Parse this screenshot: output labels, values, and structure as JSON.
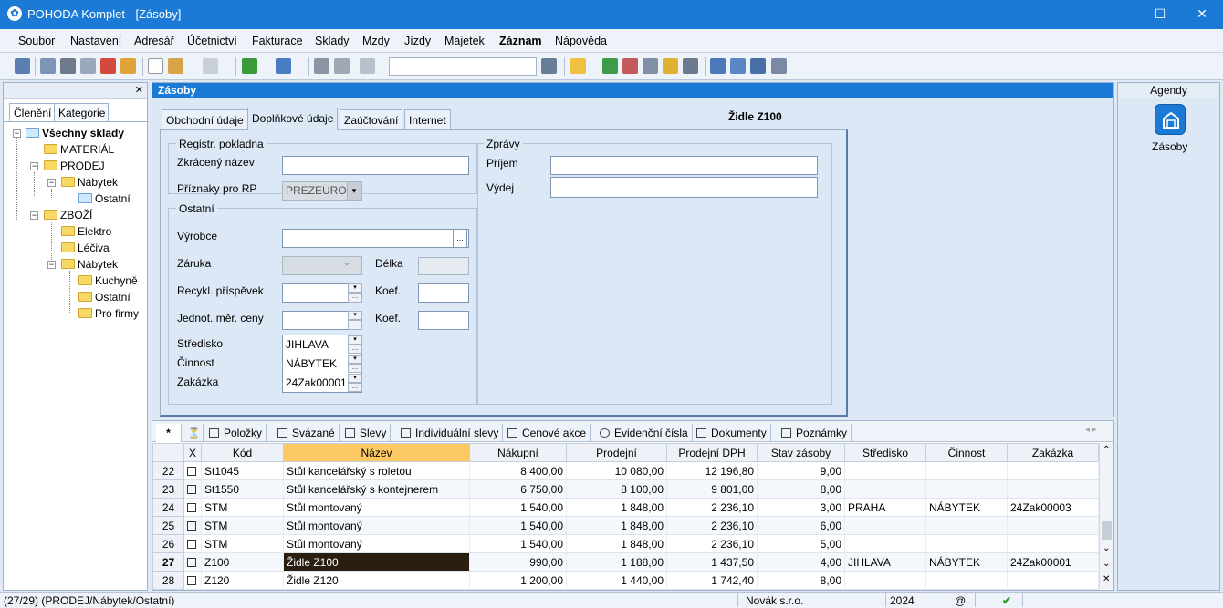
{
  "window": {
    "title": "POHODA Komplet - [Zásoby]",
    "min": "—",
    "max": "☐",
    "close": "✕"
  },
  "menu": [
    "Soubor",
    "Nastavení",
    "Adresář",
    "Účetnictví",
    "Fakturace",
    "Sklady",
    "Mzdy",
    "Jízdy",
    "Majetek",
    "Záznam",
    "Nápověda"
  ],
  "left": {
    "close": "✕",
    "tabs": [
      "Členění",
      "Kategorie"
    ],
    "tree": [
      "Všechny sklady",
      "MATERIÁL",
      "PRODEJ",
      "Nábytek",
      "Ostatní",
      "ZBOŽÍ",
      "Elektro",
      "Léčiva",
      "Nábytek",
      "Kuchyně",
      "Ostatní",
      "Pro firmy"
    ]
  },
  "main": {
    "title": "Zásoby",
    "tabs": [
      "Obchodní údaje",
      "Doplňkové údaje",
      "Zaúčtování",
      "Internet"
    ],
    "record": "Židle Z100"
  },
  "form": {
    "g1": "Registr. pokladna",
    "zkraceny": "Zkrácený název",
    "priznaky": "Příznaky pro RP",
    "priznaky_val": "PREZEURO",
    "g2": "Ostatní",
    "vyrobce": "Výrobce",
    "zaruka": "Záruka",
    "delka": "Délka",
    "recykl": "Recykl. příspěvek",
    "koef1": "Koef.",
    "jednot": "Jednot. měr. ceny",
    "koef2": "Koef.",
    "stredisko": "Středisko",
    "stredisko_val": "JIHLAVA",
    "cinnost": "Činnost",
    "cinnost_val": "NÁBYTEK",
    "zakazka": "Zakázka",
    "zakazka_val": "24Zak00001",
    "g3": "Zprávy",
    "prijem": "Příjem",
    "vydej": "Výdej",
    "dots": "..."
  },
  "agendy": {
    "title": "Agendy",
    "item": "Zásoby"
  },
  "gridtabs": [
    "*",
    "Položky",
    "Svázané",
    "Slevy",
    "Individuální slevy",
    "Cenové akce",
    "Evidenční čísla",
    "Dokumenty",
    "Poznámky"
  ],
  "columns": [
    "",
    "X",
    "Kód",
    "Název",
    "Nákupní",
    "Prodejní",
    "Prodejní DPH",
    "Stav zásoby",
    "Středisko",
    "Činnost",
    "Zakázka"
  ],
  "rows": [
    {
      "n": "22",
      "kod": "St1045",
      "nazev": "Stůl kancelářský s roletou",
      "nakup": "8 400,00",
      "prodej": "10 080,00",
      "dph": "12 196,80",
      "stav": "9,00",
      "str": "",
      "cin": "",
      "zak": ""
    },
    {
      "n": "23",
      "kod": "St1550",
      "nazev": "Stůl kancelářský s kontejnerem",
      "nakup": "6 750,00",
      "prodej": "8 100,00",
      "dph": "9 801,00",
      "stav": "8,00",
      "str": "",
      "cin": "",
      "zak": ""
    },
    {
      "n": "24",
      "kod": "STM",
      "nazev": "Stůl montovaný",
      "nakup": "1 540,00",
      "prodej": "1 848,00",
      "dph": "2 236,10",
      "stav": "3,00",
      "str": "PRAHA",
      "cin": "NÁBYTEK",
      "zak": "24Zak00003"
    },
    {
      "n": "25",
      "kod": "STM",
      "nazev": "Stůl montovaný",
      "nakup": "1 540,00",
      "prodej": "1 848,00",
      "dph": "2 236,10",
      "stav": "6,00",
      "str": "",
      "cin": "",
      "zak": ""
    },
    {
      "n": "26",
      "kod": "STM",
      "nazev": "Stůl montovaný",
      "nakup": "1 540,00",
      "prodej": "1 848,00",
      "dph": "2 236,10",
      "stav": "5,00",
      "str": "",
      "cin": "",
      "zak": ""
    },
    {
      "n": "27",
      "kod": "Z100",
      "nazev": "Židle Z100",
      "nakup": "990,00",
      "prodej": "1 188,00",
      "dph": "1 437,50",
      "stav": "4,00",
      "str": "JIHLAVA",
      "cin": "NÁBYTEK",
      "zak": "24Zak00001"
    },
    {
      "n": "28",
      "kod": "Z120",
      "nazev": "Židle Z120",
      "nakup": "1 200,00",
      "prodej": "1 440,00",
      "dph": "1 742,40",
      "stav": "8,00",
      "str": "",
      "cin": "",
      "zak": ""
    }
  ],
  "status": {
    "pos": "(27/29) (PRODEJ/Nábytek/Ostatní)",
    "firm": "Novák s.r.o.",
    "year": "2024",
    "at": "@",
    "ok": "✔"
  }
}
